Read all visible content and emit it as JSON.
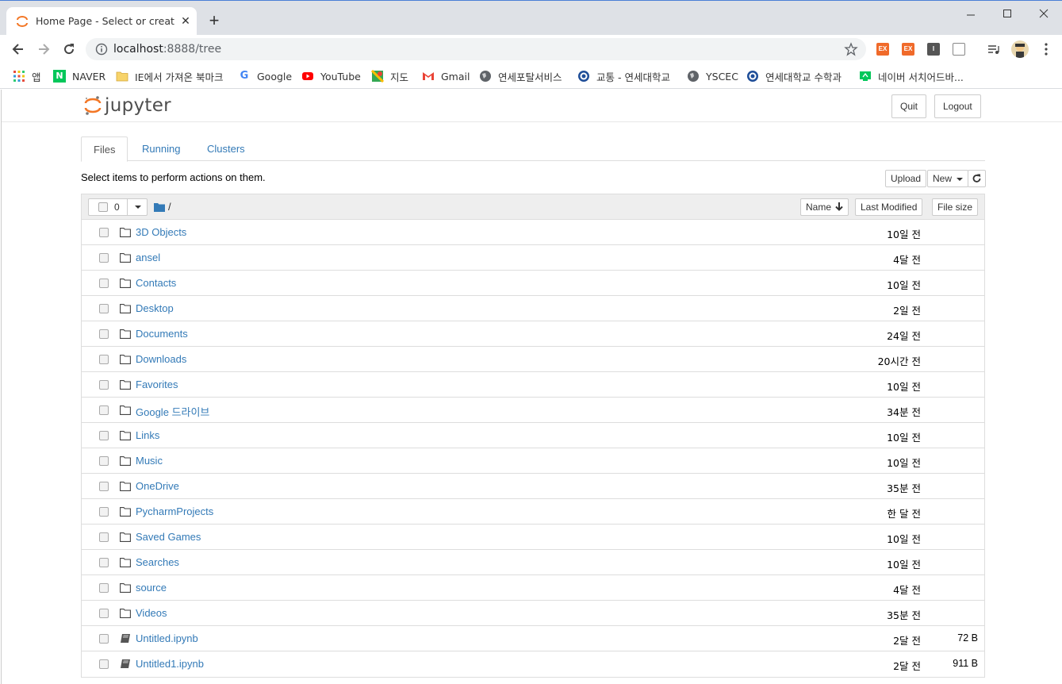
{
  "browser": {
    "tab_title": "Home Page - Select or create a notebook",
    "url_host": "localhost",
    "url_rest": ":8888/tree",
    "bookmarks": [
      {
        "label": "앱",
        "icon": "apps-grid-icon"
      },
      {
        "label": "NAVER",
        "icon": "naver-icon"
      },
      {
        "label": "IE에서 가져온 북마크",
        "icon": "folder-icon"
      },
      {
        "label": "Google",
        "icon": "google-icon"
      },
      {
        "label": "YouTube",
        "icon": "youtube-icon"
      },
      {
        "label": "지도",
        "icon": "maps-icon"
      },
      {
        "label": "Gmail",
        "icon": "gmail-icon"
      },
      {
        "label": "연세포탈서비스",
        "icon": "globe-icon"
      },
      {
        "label": "교통 - 연세대학교",
        "icon": "yonsei-seal-icon"
      },
      {
        "label": "YSCEC",
        "icon": "globe-icon"
      },
      {
        "label": "연세대학교 수학과",
        "icon": "yonsei-seal-icon"
      },
      {
        "label": "네이버 서치어드바...",
        "icon": "naver-advisor-icon"
      }
    ],
    "extensions": [
      "EX",
      "EX",
      "I"
    ]
  },
  "jupyter": {
    "logo_text": "jupyter",
    "quit_label": "Quit",
    "logout_label": "Logout",
    "tabs": [
      "Files",
      "Running",
      "Clusters"
    ],
    "instructions": "Select items to perform actions on them.",
    "upload_label": "Upload",
    "new_label": "New",
    "selected_count": "0",
    "breadcrumb": "/",
    "col_name": "Name",
    "col_modified": "Last Modified",
    "col_size": "File size",
    "items": [
      {
        "name": "3D Objects",
        "type": "folder",
        "modified": "10일 전",
        "size": ""
      },
      {
        "name": "ansel",
        "type": "folder",
        "modified": "4달 전",
        "size": ""
      },
      {
        "name": "Contacts",
        "type": "folder",
        "modified": "10일 전",
        "size": ""
      },
      {
        "name": "Desktop",
        "type": "folder",
        "modified": "2일 전",
        "size": ""
      },
      {
        "name": "Documents",
        "type": "folder",
        "modified": "24일 전",
        "size": ""
      },
      {
        "name": "Downloads",
        "type": "folder",
        "modified": "20시간 전",
        "size": ""
      },
      {
        "name": "Favorites",
        "type": "folder",
        "modified": "10일 전",
        "size": ""
      },
      {
        "name": "Google 드라이브",
        "type": "folder",
        "modified": "34분 전",
        "size": ""
      },
      {
        "name": "Links",
        "type": "folder",
        "modified": "10일 전",
        "size": ""
      },
      {
        "name": "Music",
        "type": "folder",
        "modified": "10일 전",
        "size": ""
      },
      {
        "name": "OneDrive",
        "type": "folder",
        "modified": "35분 전",
        "size": ""
      },
      {
        "name": "PycharmProjects",
        "type": "folder",
        "modified": "한 달 전",
        "size": ""
      },
      {
        "name": "Saved Games",
        "type": "folder",
        "modified": "10일 전",
        "size": ""
      },
      {
        "name": "Searches",
        "type": "folder",
        "modified": "10일 전",
        "size": ""
      },
      {
        "name": "source",
        "type": "folder",
        "modified": "4달 전",
        "size": ""
      },
      {
        "name": "Videos",
        "type": "folder",
        "modified": "35분 전",
        "size": ""
      },
      {
        "name": "Untitled.ipynb",
        "type": "notebook",
        "modified": "2달 전",
        "size": "72 B"
      },
      {
        "name": "Untitled1.ipynb",
        "type": "notebook",
        "modified": "2달 전",
        "size": "911 B"
      }
    ]
  }
}
